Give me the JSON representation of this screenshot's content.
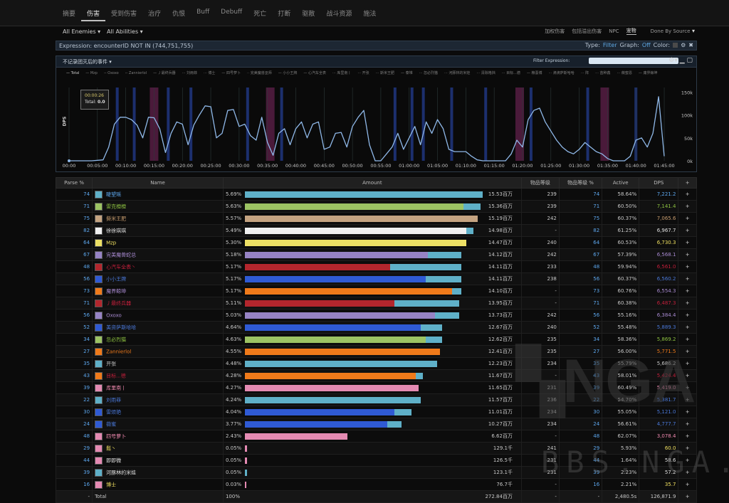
{
  "nav": {
    "tabs": [
      "摘要",
      "伤害",
      "受到伤害",
      "治疗",
      "仇恨",
      "Buff",
      "Debuff",
      "死亡",
      "打断",
      "驱散",
      "战斗资源",
      "施法"
    ],
    "active_index": 1
  },
  "filters": {
    "enemies": "All Enemies",
    "abilities": "All Abilities",
    "right_options": [
      "加权伤害",
      "包括溢出伤害",
      "NPC",
      "宠物"
    ],
    "selected_option": "宠物",
    "done_by": "Done By Source"
  },
  "expression": {
    "text": "Expression: encounterID NOT IN (744,751,755)",
    "type_label": "Type:",
    "type_value": "Filter",
    "graph_label": "Graph:",
    "graph_value": "Off",
    "color_label": "Color:"
  },
  "graph": {
    "title": "不记录团灭后的事件",
    "filter_label": "Filter Expression:",
    "y_label": "DPS",
    "legend": [
      "— Total",
      "— Mzp",
      "-- Oxoxo",
      "-- Zannierlol",
      "— 丿最终兵器",
      "··· 刘雨菲",
      "··· 博士",
      "— 四号萝卜",
      "·· 完美魔兽巫师",
      "— 小小王牌",
      "— 心汽车全表",
      "··· 库里南丨",
      "··· 开张",
      "··· 斯米王肥",
      "— 泰堆",
      "··· 忽必烈猫",
      "··· 河豚林的米娃",
      "··· 清除格挡",
      "··· 目标...德",
      "— 粮薏博",
      "··· 滴滴萨斯哈哈",
      "··· 阵",
      "··· 苗种鑫",
      "··· 薇蜜恩",
      "— 庸界鲸坤"
    ],
    "tooltip": {
      "time": "00:00:26",
      "total_label": "Total:",
      "total_value": "0.0"
    },
    "colors": {
      "line": "#8fb8e8",
      "marker_blue": "#1c2f6e",
      "marker_red": "#4a1a3a"
    },
    "chart_data": {
      "type": "line",
      "x_ticks": [
        "00:00",
        "00:05:00",
        "00:10:00",
        "00:15:00",
        "00:20:00",
        "00:25:00",
        "00:30:00",
        "00:35:00",
        "00:40:00",
        "00:45:00",
        "00:50:00",
        "00:55:00",
        "01:00:00",
        "01:05:00",
        "01:10:00",
        "01:15:00",
        "01:20:00",
        "01:25:00",
        "01:30:00",
        "01:35:00",
        "01:40:00",
        "01:45:00"
      ],
      "y_ticks": [
        "0k",
        "50k",
        "100k",
        "150k"
      ],
      "ylim": [
        0,
        160
      ],
      "xlim": [
        0,
        106
      ],
      "series": [
        {
          "name": "Total",
          "x": [
            0,
            2,
            4,
            6,
            7,
            8,
            9,
            10,
            11,
            12,
            13,
            14,
            15,
            16,
            17,
            18,
            19,
            20,
            21,
            22,
            23,
            24,
            25,
            26,
            27,
            28,
            29,
            30,
            31,
            32,
            33,
            34,
            35,
            36,
            37,
            38,
            39,
            40,
            41,
            42,
            43,
            44,
            45,
            46,
            47,
            48,
            49,
            50,
            51,
            52,
            53,
            54,
            55,
            56,
            57,
            58,
            59,
            60,
            61,
            62,
            63,
            64,
            65,
            66,
            67,
            68,
            69,
            70,
            71,
            72,
            73,
            74,
            75,
            76,
            77,
            78,
            79,
            80,
            81,
            82,
            83,
            84,
            85,
            86,
            87,
            88,
            89,
            90,
            91,
            92,
            93,
            94,
            95,
            96,
            97,
            98,
            99,
            100,
            101,
            102,
            103,
            104,
            105
          ],
          "y": [
            0,
            0,
            0,
            2,
            30,
            80,
            95,
            95,
            90,
            78,
            50,
            95,
            94,
            70,
            18,
            60,
            85,
            80,
            35,
            78,
            100,
            120,
            118,
            50,
            60,
            110,
            112,
            75,
            80,
            55,
            45,
            95,
            40,
            12,
            60,
            70,
            35,
            70,
            85,
            50,
            80,
            85,
            25,
            30,
            60,
            62,
            30,
            75,
            95,
            110,
            35,
            0,
            0,
            15,
            30,
            60,
            25,
            50,
            75,
            35,
            85,
            60,
            90,
            70,
            25,
            20,
            20,
            20,
            10,
            2,
            0,
            0,
            0,
            0,
            0,
            15,
            45,
            30,
            90,
            110,
            115,
            85,
            65,
            45,
            30,
            20,
            15,
            25,
            40,
            30,
            20,
            15,
            5,
            0,
            0,
            0,
            10,
            45,
            50,
            30,
            60,
            140,
            10
          ]
        }
      ],
      "markers_blue": [
        8.5,
        11.5,
        17.5,
        21.5,
        31.5,
        37.5,
        57.5,
        60.5,
        62.5,
        67.5,
        73.5,
        81.5,
        91.5,
        100
      ],
      "markers_red": [
        15,
        35.5,
        79.5,
        94.5
      ]
    }
  },
  "table": {
    "headers": [
      "Parse %",
      "Name",
      "Amount",
      "物品等级",
      "物品等级 %",
      "Active",
      "DPS",
      "+"
    ],
    "rows": [
      {
        "parse": "74",
        "name": "睫望瑶",
        "pct": "5.69%",
        "amount": "15.53百万",
        "ilvl": "239",
        "ilvlp": "74",
        "active": "58.64%",
        "dps": "7,221.2",
        "color": "#5da7ee",
        "bar": "#5fb0c8",
        "b1": 1.0,
        "b2": 0.0
      },
      {
        "parse": "71",
        "name": "雷克橙橙",
        "pct": "5.63%",
        "amount": "15.36百万",
        "ilvl": "239",
        "ilvlp": "71",
        "active": "60.50%",
        "dps": "7,141.4",
        "color": "#8cc040",
        "bar": "#9cc363",
        "b1": 0.92,
        "b2": 0.07
      },
      {
        "parse": "75",
        "name": "撕米王肥",
        "pct": "5.57%",
        "amount": "15.19百万",
        "ilvl": "242",
        "ilvlp": "75",
        "active": "60.37%",
        "dps": "7,065.6",
        "color": "#c79c6e",
        "bar": "#c4a381",
        "b1": 0.98,
        "b2": 0.0
      },
      {
        "parse": "82",
        "name": "徐徐琪琪",
        "pct": "5.49%",
        "amount": "14.98百万",
        "ilvl": "-",
        "ilvlp": "82",
        "active": "61.25%",
        "dps": "6,967.7",
        "color": "#e0e0e0",
        "bar": "#f0f0f0",
        "b1": 0.93,
        "b2": 0.03
      },
      {
        "parse": "64",
        "name": "Mzp",
        "pct": "5.30%",
        "amount": "14.47百万",
        "ilvl": "240",
        "ilvlp": "64",
        "active": "60.53%",
        "dps": "6,730.3",
        "color": "#f0e060",
        "bar": "#ede065",
        "b1": 0.93,
        "b2": 0.0
      },
      {
        "parse": "67",
        "name": "完美魔兽蛇总",
        "pct": "5.18%",
        "amount": "14.12百万",
        "ilvl": "242",
        "ilvlp": "67",
        "active": "57.39%",
        "dps": "6,568.1",
        "color": "#a88ad0",
        "bar": "#9683c4",
        "b1": 0.77,
        "b2": 0.14
      },
      {
        "parse": "48",
        "name": "心汽车全表丶",
        "pct": "5.17%",
        "amount": "14.11百万",
        "ilvl": "233",
        "ilvlp": "48",
        "active": "59.94%",
        "dps": "6,561.0",
        "color": "#c41f3b",
        "bar": "#b3262d",
        "b1": 0.61,
        "b2": 0.3
      },
      {
        "parse": "56",
        "name": "小小王牌",
        "pct": "5.17%",
        "amount": "14.11百万",
        "ilvl": "238",
        "ilvlp": "56",
        "active": "60.37%",
        "dps": "6,560.2",
        "color": "#4a78d8",
        "bar": "#2f5ad4",
        "b1": 0.76,
        "b2": 0.15
      },
      {
        "parse": "73",
        "name": "魔界鲸坤",
        "pct": "5.17%",
        "amount": "14.10百万",
        "ilvl": "-",
        "ilvlp": "73",
        "active": "60.76%",
        "dps": "6,554.3",
        "color": "#a88ad0",
        "bar": "#f07a1a",
        "b1": 0.87,
        "b2": 0.04
      },
      {
        "parse": "71",
        "name": "丿最终兵器",
        "pct": "5.11%",
        "amount": "13.95百万",
        "ilvl": "-",
        "ilvlp": "71",
        "active": "60.38%",
        "dps": "6,487.3",
        "color": "#c41f3b",
        "bar": "#b3262d",
        "b1": 0.63,
        "b2": 0.27
      },
      {
        "parse": "56",
        "name": "Oxoxo",
        "pct": "5.03%",
        "amount": "13.73百万",
        "ilvl": "242",
        "ilvlp": "56",
        "active": "55.16%",
        "dps": "6,384.4",
        "color": "#a88ad0",
        "bar": "#9683c4",
        "b1": 0.8,
        "b2": 0.1
      },
      {
        "parse": "52",
        "name": "美资萨斯哈哈",
        "pct": "4.64%",
        "amount": "12.67百万",
        "ilvl": "240",
        "ilvlp": "52",
        "active": "55.48%",
        "dps": "5,889.3",
        "color": "#4a78d8",
        "bar": "#2f5ad4",
        "b1": 0.74,
        "b2": 0.09
      },
      {
        "parse": "34",
        "name": "忽必烈猫",
        "pct": "4.63%",
        "amount": "12.62百万",
        "ilvl": "235",
        "ilvlp": "34",
        "active": "58.36%",
        "dps": "5,869.2",
        "color": "#8cc040",
        "bar": "#9cc363",
        "b1": 0.76,
        "b2": 0.07
      },
      {
        "parse": "27",
        "name": "Zannierlol",
        "pct": "4.55%",
        "amount": "12.41百万",
        "ilvl": "235",
        "ilvlp": "27",
        "active": "56.00%",
        "dps": "5,771.5",
        "color": "#f07a1a",
        "bar": "#f07a1a",
        "b1": 0.82,
        "b2": 0.0
      },
      {
        "parse": "35",
        "name": "开张",
        "pct": "4.48%",
        "amount": "12.23百万",
        "ilvl": "234",
        "ilvlp": "35",
        "active": "55.79%",
        "dps": "5,686.2",
        "color": "#c8c8c8",
        "bar": "#5fb0c8",
        "b1": 0.81,
        "b2": 0.0
      },
      {
        "parse": "43",
        "name": "目标...德",
        "pct": "4.28%",
        "amount": "11.67百万",
        "ilvl": "-",
        "ilvlp": "43",
        "active": "58.01%",
        "dps": "5,424.4",
        "color": "#c41f3b",
        "bar": "#f07a1a",
        "b1": 0.72,
        "b2": 0.03
      },
      {
        "parse": "39",
        "name": "库里南丨",
        "pct": "4.27%",
        "amount": "11.65百万",
        "ilvl": "231",
        "ilvlp": "39",
        "active": "60.49%",
        "dps": "5,419.0",
        "color": "#f08ab0",
        "bar": "#e48ab2",
        "b1": 0.73,
        "b2": 0.0
      },
      {
        "parse": "22",
        "name": "刘雨菲",
        "pct": "4.24%",
        "amount": "11.57百万",
        "ilvl": "236",
        "ilvlp": "22",
        "active": "54.70%",
        "dps": "5,381.7",
        "color": "#4a78d8",
        "bar": "#5fb0c8",
        "b1": 0.74,
        "b2": 0.0
      },
      {
        "parse": "30",
        "name": "雷烦艳",
        "pct": "4.04%",
        "amount": "11.01百万",
        "ilvl": "234",
        "ilvlp": "30",
        "active": "55.05%",
        "dps": "5,121.0",
        "color": "#4a78d8",
        "bar": "#2f5ad4",
        "b1": 0.63,
        "b2": 0.07
      },
      {
        "parse": "24",
        "name": "薇蜜",
        "pct": "3.77%",
        "amount": "10.27百万",
        "ilvl": "234",
        "ilvlp": "24",
        "active": "56.61%",
        "dps": "4,777.7",
        "color": "#4a78d8",
        "bar": "#2f5ad4",
        "b1": 0.6,
        "b2": 0.06
      },
      {
        "parse": "48",
        "name": "四号萝卜",
        "pct": "2.43%",
        "amount": "6.62百万",
        "ilvl": "-",
        "ilvlp": "48",
        "active": "62.07%",
        "dps": "3,078.4",
        "color": "#f08ab0",
        "bar": "#e48ab2",
        "b1": 0.43,
        "b2": 0.0
      },
      {
        "parse": "29",
        "name": "鬆丶",
        "pct": "0.05%",
        "amount": "129.1千",
        "ilvl": "241",
        "ilvlp": "29",
        "active": "5.93%",
        "dps": "60.0",
        "color": "#f0e060",
        "bar": "#e48ab2",
        "b1": 0.008,
        "b2": 0.0
      },
      {
        "parse": "44",
        "name": "即即微",
        "pct": "0.05%",
        "amount": "126.5千",
        "ilvl": "231",
        "ilvlp": "44",
        "active": "1.64%",
        "dps": "58.6",
        "color": "#e0e0e0",
        "bar": "#e48ab2",
        "b1": 0.008,
        "b2": 0.0
      },
      {
        "parse": "39",
        "name": "河豚林的米娃",
        "pct": "0.05%",
        "amount": "123.1千",
        "ilvl": "231",
        "ilvlp": "39",
        "active": "2.23%",
        "dps": "57.2",
        "color": "#e0e0e0",
        "bar": "#5fb0c8",
        "b1": 0.008,
        "b2": 0.0
      },
      {
        "parse": "16",
        "name": "博士",
        "pct": "0.03%",
        "amount": "76.7千",
        "ilvl": "-",
        "ilvlp": "16",
        "active": "2.21%",
        "dps": "35.7",
        "color": "#f0e060",
        "bar": "#e48ab2",
        "b1": 0.005,
        "b2": 0.0
      }
    ],
    "total": {
      "parse": "-",
      "name": "Total",
      "pct": "100%",
      "amount": "272.84百万",
      "ilvl": "-",
      "ilvlp": "-",
      "active": "2,480.5s",
      "dps": "126,871.9"
    }
  },
  "watermark": {
    "logo": "NGA",
    "site": "BBS.NGA.CN"
  }
}
